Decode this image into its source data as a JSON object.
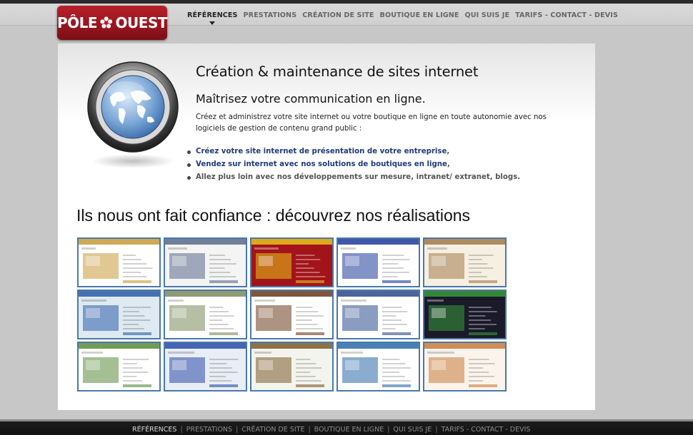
{
  "brand": {
    "left": "PÔLE",
    "right": "OUEST",
    "color": "#9b1520"
  },
  "nav": {
    "items": [
      "RÉFÉRENCES",
      "PRESTATIONS",
      "CRÉATION DE SITE",
      "BOUTIQUE EN LIGNE",
      "QUI SUIS JE",
      "TARIFS - CONTACT - DEVIS"
    ],
    "active": "RÉFÉRENCES"
  },
  "hero": {
    "icon": "globe-icon",
    "title": "Création & maintenance de sites internet",
    "subtitle": "Maîtrisez votre communication en ligne.",
    "intro": "Créez et administrez votre site internet ou votre boutique en ligne  en toute autonomie avec nos logiciels de gestion de contenu grand public :",
    "bullets": [
      {
        "link": "Créez votre site internet de présentation de votre entreprise",
        "rest": ","
      },
      {
        "link": "Vendez sur internet avec nos solutions de boutiques en ligne",
        "rest": ","
      },
      {
        "link": "",
        "rest": "Allez plus loin avec nos  développements  sur mesure,  intranet/ extranet, blogs."
      }
    ],
    "link_color": "#1e3a7a"
  },
  "references": {
    "title": "Ils nous ont fait confiance : découvrez nos réalisations",
    "thumb_border_color": "#4a78a8",
    "thumbnails": [
      {
        "name": "ref-1",
        "bg": "#ffffff",
        "accent": "#c89a3a"
      },
      {
        "name": "ref-2",
        "bg": "#f4f4f4",
        "accent": "#5a6a8a"
      },
      {
        "name": "ref-3",
        "bg": "#a3141a",
        "accent": "#e8c21a"
      },
      {
        "name": "ref-4",
        "bg": "#ffffff",
        "accent": "#1e3a9a"
      },
      {
        "name": "ref-5",
        "bg": "#f6efe2",
        "accent": "#a07a4a"
      },
      {
        "name": "ref-6",
        "bg": "#dfe9f2",
        "accent": "#2a5ca8"
      },
      {
        "name": "ref-7",
        "bg": "#ffffff",
        "accent": "#7a8a5a"
      },
      {
        "name": "ref-8",
        "bg": "#ffffff",
        "accent": "#6a3a1a"
      },
      {
        "name": "ref-9",
        "bg": "#ffffff",
        "accent": "#2a4a8a"
      },
      {
        "name": "ref-10",
        "bg": "#1a1a2a",
        "accent": "#3a9a3a"
      },
      {
        "name": "ref-11",
        "bg": "#ffffff",
        "accent": "#5a8a3a"
      },
      {
        "name": "ref-12",
        "bg": "#e8eef6",
        "accent": "#2a4aa8"
      },
      {
        "name": "ref-13",
        "bg": "#f4f4ee",
        "accent": "#7a5a2a"
      },
      {
        "name": "ref-14",
        "bg": "#ffffff",
        "accent": "#2a6aa8"
      },
      {
        "name": "ref-15",
        "bg": "#fbf4ec",
        "accent": "#c87a3a"
      }
    ]
  },
  "footer": {
    "items": [
      "RÉFÉRENCES",
      "PRESTATIONS",
      "CRÉATION DE SITE",
      "BOUTIQUE EN LIGNE",
      "QUI SUIS JE",
      "TARIFS - CONTACT - DEVIS"
    ],
    "active": "RÉFÉRENCES",
    "separator": "|"
  }
}
